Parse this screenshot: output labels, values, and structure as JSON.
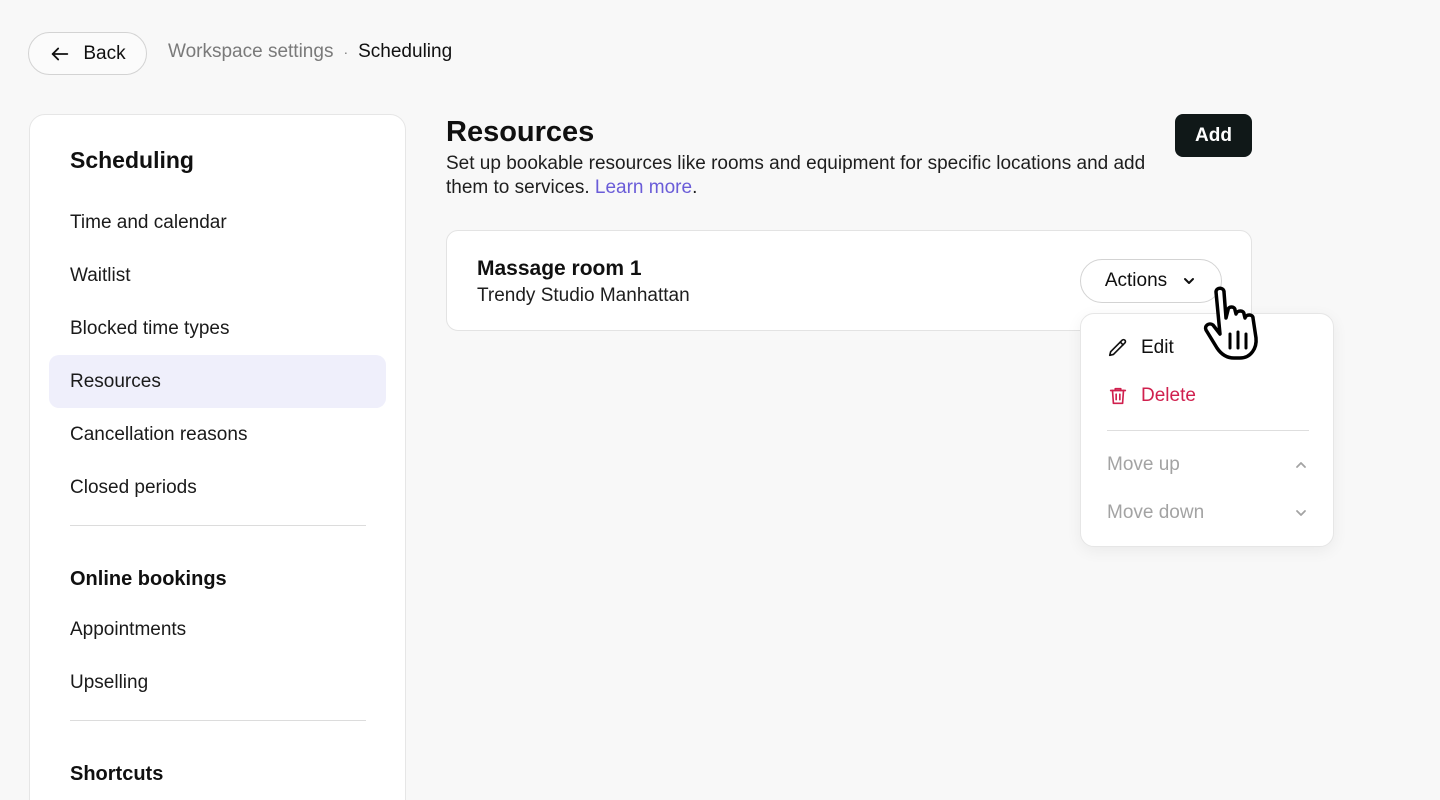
{
  "topbar": {
    "back_label": "Back",
    "breadcrumb_parent": "Workspace settings",
    "breadcrumb_separator": "·",
    "breadcrumb_current": "Scheduling"
  },
  "sidebar": {
    "heading": "Scheduling",
    "scheduling_items": [
      {
        "label": "Time and calendar"
      },
      {
        "label": "Waitlist"
      },
      {
        "label": "Blocked time types"
      },
      {
        "label": "Resources",
        "active": true
      },
      {
        "label": "Cancellation reasons"
      },
      {
        "label": "Closed periods"
      }
    ],
    "online_heading": "Online bookings",
    "online_items": [
      {
        "label": "Appointments"
      },
      {
        "label": "Upselling"
      }
    ],
    "shortcuts_heading": "Shortcuts"
  },
  "main": {
    "title": "Resources",
    "description": "Set up bookable resources like rooms and equipment for specific locations and add them to services.",
    "learn_more": "Learn more",
    "add_label": "Add"
  },
  "resource": {
    "name": "Massage room 1",
    "location": "Trendy Studio Manhattan",
    "actions_label": "Actions"
  },
  "menu": {
    "edit": "Edit",
    "delete": "Delete",
    "move_up": "Move up",
    "move_down": "Move down"
  },
  "icons": {
    "back": "arrow-left-icon",
    "actions": "chevron-down-icon",
    "edit": "pencil-icon",
    "delete": "trash-icon",
    "move_up": "chevron-up-icon",
    "move_down": "chevron-down-icon",
    "cursor": "hand-pointer-icon"
  },
  "colors": {
    "accent_link": "#6a5cd8",
    "danger": "#d0204e",
    "primary_button": "#101818",
    "active_nav_bg": "#efeffb"
  }
}
